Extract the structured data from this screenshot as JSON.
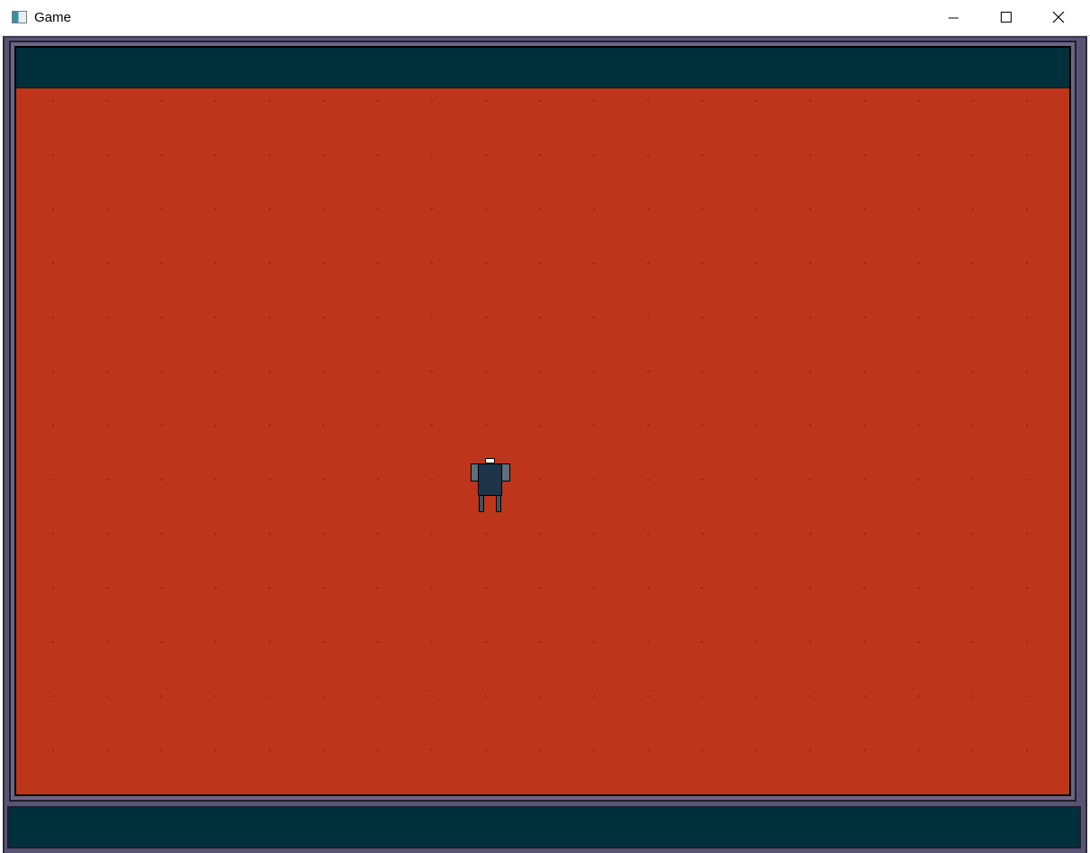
{
  "window": {
    "title": "Game",
    "icon": "app-window-icon",
    "controls": {
      "minimize_icon": "minimize-icon",
      "maximize_icon": "maximize-icon",
      "close_icon": "close-icon"
    }
  },
  "game": {
    "colors": {
      "floor": "#bd351b",
      "floor_dot": "#8e2413",
      "hud_bar": "#00303c",
      "frame": "#595374",
      "player_body": "#1d344a",
      "player_arm": "#5f6f7d",
      "player_head": "#ffffff"
    },
    "hud": {
      "top_bar": "",
      "bottom_bar": ""
    },
    "player": {
      "sprite": "robot-player-sprite"
    }
  }
}
